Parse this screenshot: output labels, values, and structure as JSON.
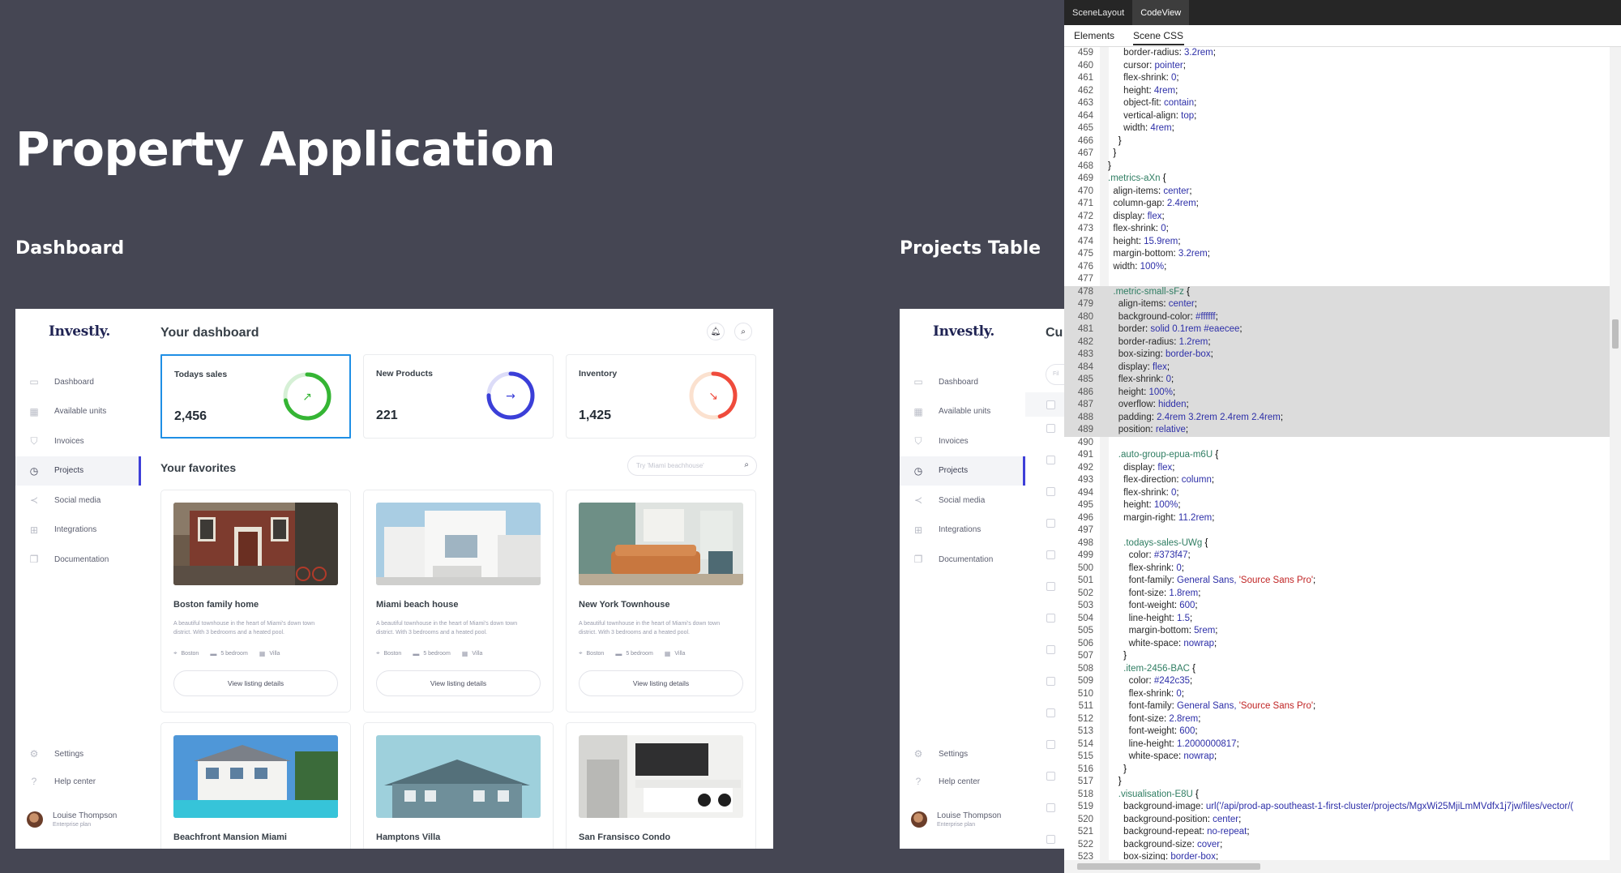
{
  "canvas": {
    "title": "Property Application",
    "frames": [
      {
        "label": "Dashboard"
      },
      {
        "label": "Projects Table"
      }
    ]
  },
  "dashboard": {
    "logo": "Investly.",
    "nav": [
      {
        "label": "Dashboard",
        "icon": "browser-icon"
      },
      {
        "label": "Available units",
        "icon": "building-icon"
      },
      {
        "label": "Invoices",
        "icon": "shield-check-icon"
      },
      {
        "label": "Projects",
        "icon": "clock-icon",
        "active": true
      },
      {
        "label": "Social media",
        "icon": "share-icon"
      },
      {
        "label": "Integrations",
        "icon": "grid-icon"
      },
      {
        "label": "Documentation",
        "icon": "docs-icon"
      }
    ],
    "nav_bottom": [
      {
        "label": "Settings",
        "icon": "gear-icon"
      },
      {
        "label": "Help center",
        "icon": "help-icon"
      }
    ],
    "user": {
      "name": "Louise Thompson",
      "plan": "Enterprise plan"
    },
    "title": "Your dashboard",
    "metrics": [
      {
        "label": "Todays sales",
        "value": "2,456",
        "color": "#35b534",
        "track": "#d6f0d6",
        "icon": "trend-up-icon",
        "progress": 0.72
      },
      {
        "label": "New Products",
        "value": "221",
        "color": "#3b3fd8",
        "track": "#dcdcf8",
        "icon": "arrow-right-icon",
        "progress": 0.75
      },
      {
        "label": "Inventory",
        "value": "1,425",
        "color": "#ef4b3c",
        "track": "#fbe1cf",
        "icon": "trend-down-icon",
        "progress": 0.45
      }
    ],
    "favorites_title": "Your favorites",
    "search_placeholder": "Try 'Miami beachhouse'",
    "cards": [
      {
        "title": "Boston family home",
        "desc": "A beautiful townhouse in the heart of Miami's down town district. With 3 bedrooms and a heated pool.",
        "location": "Boston",
        "bedrooms": "5 bedroom",
        "type": "Villa",
        "button": "View listing details"
      },
      {
        "title": "Miami beach house",
        "desc": "A beautiful townhouse in the heart of Miami's down town district. With 3 bedrooms and a heated pool.",
        "location": "Boston",
        "bedrooms": "5 bedroom",
        "type": "Villa",
        "button": "View listing details"
      },
      {
        "title": "New York Townhouse",
        "desc": "A beautiful townhouse in the heart of Miami's down town district. With 3 bedrooms and a heated pool.",
        "location": "Boston",
        "bedrooms": "5 bedroom",
        "type": "Villa",
        "button": "View listing details"
      },
      {
        "title": "Beachfront Mansion Miami"
      },
      {
        "title": "Hamptons Villa"
      },
      {
        "title": "San Fransisco Condo"
      }
    ]
  },
  "projects": {
    "logo": "Investly.",
    "title_partial": "Cu",
    "search_partial": "Fil"
  },
  "panel": {
    "top_tabs": [
      "SceneLayout",
      "CodeView"
    ],
    "sub_tabs": [
      "Elements",
      "Scene CSS"
    ],
    "code_lines": [
      {
        "n": "459",
        "t": "      border-radius: 3.2rem;"
      },
      {
        "n": "460",
        "t": "      cursor: pointer;"
      },
      {
        "n": "461",
        "t": "      flex-shrink: 0;"
      },
      {
        "n": "462",
        "t": "      height: 4rem;"
      },
      {
        "n": "463",
        "t": "      object-fit: contain;"
      },
      {
        "n": "464",
        "t": "      vertical-align: top;"
      },
      {
        "n": "465",
        "t": "      width: 4rem;"
      },
      {
        "n": "466",
        "t": "    }"
      },
      {
        "n": "467",
        "t": "  }"
      },
      {
        "n": "468",
        "t": "}"
      },
      {
        "n": "469",
        "t": ".metrics-aXn {"
      },
      {
        "n": "470",
        "t": "  align-items: center;"
      },
      {
        "n": "471",
        "t": "  column-gap: 2.4rem;"
      },
      {
        "n": "472",
        "t": "  display: flex;"
      },
      {
        "n": "473",
        "t": "  flex-shrink: 0;"
      },
      {
        "n": "474",
        "t": "  height: 15.9rem;"
      },
      {
        "n": "475",
        "t": "  margin-bottom: 3.2rem;"
      },
      {
        "n": "476",
        "t": "  width: 100%;"
      },
      {
        "n": "477",
        "t": ""
      },
      {
        "n": "478",
        "t": "  .metric-small-sFz {",
        "hl": true
      },
      {
        "n": "479",
        "t": "    align-items: center;",
        "hl": true
      },
      {
        "n": "480",
        "t": "    background-color: #ffffff;",
        "hl": true
      },
      {
        "n": "481",
        "t": "    border: solid 0.1rem #eaecee;",
        "hl": true
      },
      {
        "n": "482",
        "t": "    border-radius: 1.2rem;",
        "hl": true
      },
      {
        "n": "483",
        "t": "    box-sizing: border-box;",
        "hl": true
      },
      {
        "n": "484",
        "t": "    display: flex;",
        "hl": true
      },
      {
        "n": "485",
        "t": "    flex-shrink: 0;",
        "hl": true
      },
      {
        "n": "486",
        "t": "    height: 100%;",
        "hl": true
      },
      {
        "n": "487",
        "t": "    overflow: hidden;",
        "hl": true
      },
      {
        "n": "488",
        "t": "    padding: 2.4rem 3.2rem 2.4rem 2.4rem;",
        "hl": true
      },
      {
        "n": "489",
        "t": "    position: relative;",
        "hl": true
      },
      {
        "n": "490",
        "t": ""
      },
      {
        "n": "491",
        "t": "    .auto-group-epua-m6U {"
      },
      {
        "n": "492",
        "t": "      display: flex;"
      },
      {
        "n": "493",
        "t": "      flex-direction: column;"
      },
      {
        "n": "494",
        "t": "      flex-shrink: 0;"
      },
      {
        "n": "495",
        "t": "      height: 100%;"
      },
      {
        "n": "496",
        "t": "      margin-right: 11.2rem;"
      },
      {
        "n": "497",
        "t": ""
      },
      {
        "n": "498",
        "t": "      .todays-sales-UWg {"
      },
      {
        "n": "499",
        "t": "        color: #373f47;"
      },
      {
        "n": "500",
        "t": "        flex-shrink: 0;"
      },
      {
        "n": "501",
        "t": "        font-family: General Sans, 'Source Sans Pro';"
      },
      {
        "n": "502",
        "t": "        font-size: 1.8rem;"
      },
      {
        "n": "503",
        "t": "        font-weight: 600;"
      },
      {
        "n": "504",
        "t": "        line-height: 1.5;"
      },
      {
        "n": "505",
        "t": "        margin-bottom: 5rem;"
      },
      {
        "n": "506",
        "t": "        white-space: nowrap;"
      },
      {
        "n": "507",
        "t": "      }"
      },
      {
        "n": "508",
        "t": "      .item-2456-BAC {"
      },
      {
        "n": "509",
        "t": "        color: #242c35;"
      },
      {
        "n": "510",
        "t": "        flex-shrink: 0;"
      },
      {
        "n": "511",
        "t": "        font-family: General Sans, 'Source Sans Pro';"
      },
      {
        "n": "512",
        "t": "        font-size: 2.8rem;"
      },
      {
        "n": "513",
        "t": "        font-weight: 600;"
      },
      {
        "n": "514",
        "t": "        line-height: 1.2000000817;"
      },
      {
        "n": "515",
        "t": "        white-space: nowrap;"
      },
      {
        "n": "516",
        "t": "      }"
      },
      {
        "n": "517",
        "t": "    }"
      },
      {
        "n": "518",
        "t": "    .visualisation-E8U {"
      },
      {
        "n": "519",
        "t": "      background-image: url('/api/prod-ap-southeast-1-first-cluster/projects/MgxWi25MjiLmMVdfx1j7jw/files/vector/("
      },
      {
        "n": "520",
        "t": "      background-position: center;"
      },
      {
        "n": "521",
        "t": "      background-repeat: no-repeat;"
      },
      {
        "n": "522",
        "t": "      background-size: cover;"
      },
      {
        "n": "523",
        "t": "      box-sizing: border-box;"
      }
    ]
  }
}
